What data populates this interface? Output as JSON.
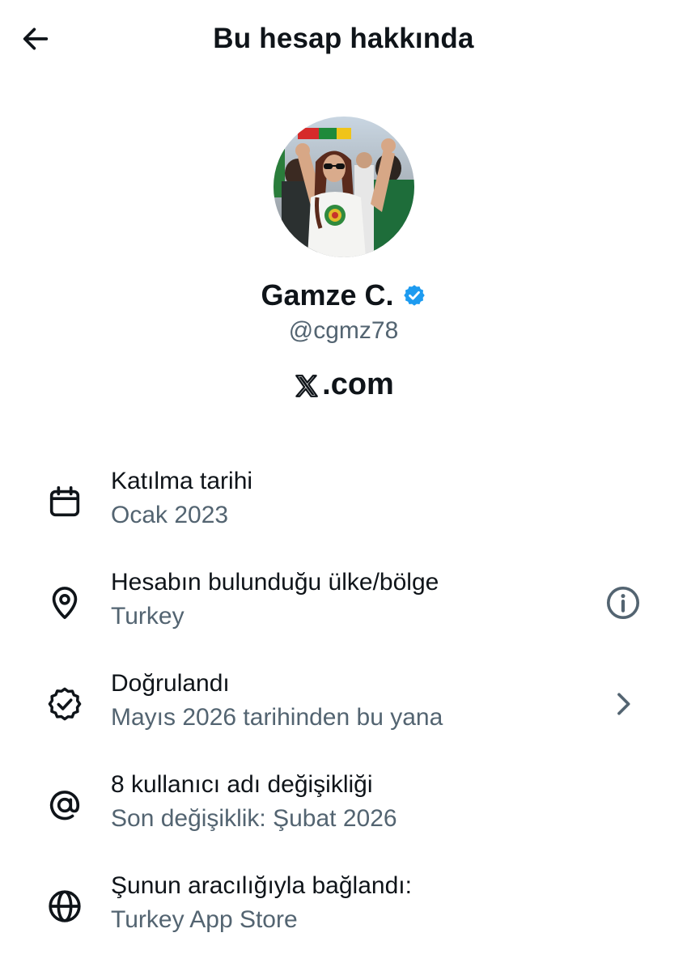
{
  "header": {
    "title": "Bu hesap hakkında",
    "back_icon": "arrow-left-icon"
  },
  "profile": {
    "display_name": "Gamze C.",
    "handle": "@cgmz78",
    "verified": true,
    "verified_color": "#1d9bf0",
    "platform_text": ".com",
    "platform_logo": "x-logo-icon"
  },
  "details": [
    {
      "icon": "calendar-icon",
      "title": "Katılma tarihi",
      "value": "Ocak 2023"
    },
    {
      "icon": "location-pin-icon",
      "title": "Hesabın bulunduğu ülke/bölge",
      "value": "Turkey",
      "trailing_icon": "info-icon"
    },
    {
      "icon": "verified-badge-outline-icon",
      "title": "Doğrulandı",
      "value": "Mayıs 2026 tarihinden bu yana",
      "trailing_icon": "chevron-right-icon"
    },
    {
      "icon": "at-sign-icon",
      "title": "8 kullanıcı adı değişikliği",
      "value": "Son değişiklik: Şubat 2026"
    },
    {
      "icon": "globe-icon",
      "title": "Şunun aracılığıyla bağlandı:",
      "value": "Turkey App Store"
    }
  ],
  "colors": {
    "text_primary": "#0f1419",
    "text_secondary": "#536471",
    "background": "#ffffff"
  }
}
